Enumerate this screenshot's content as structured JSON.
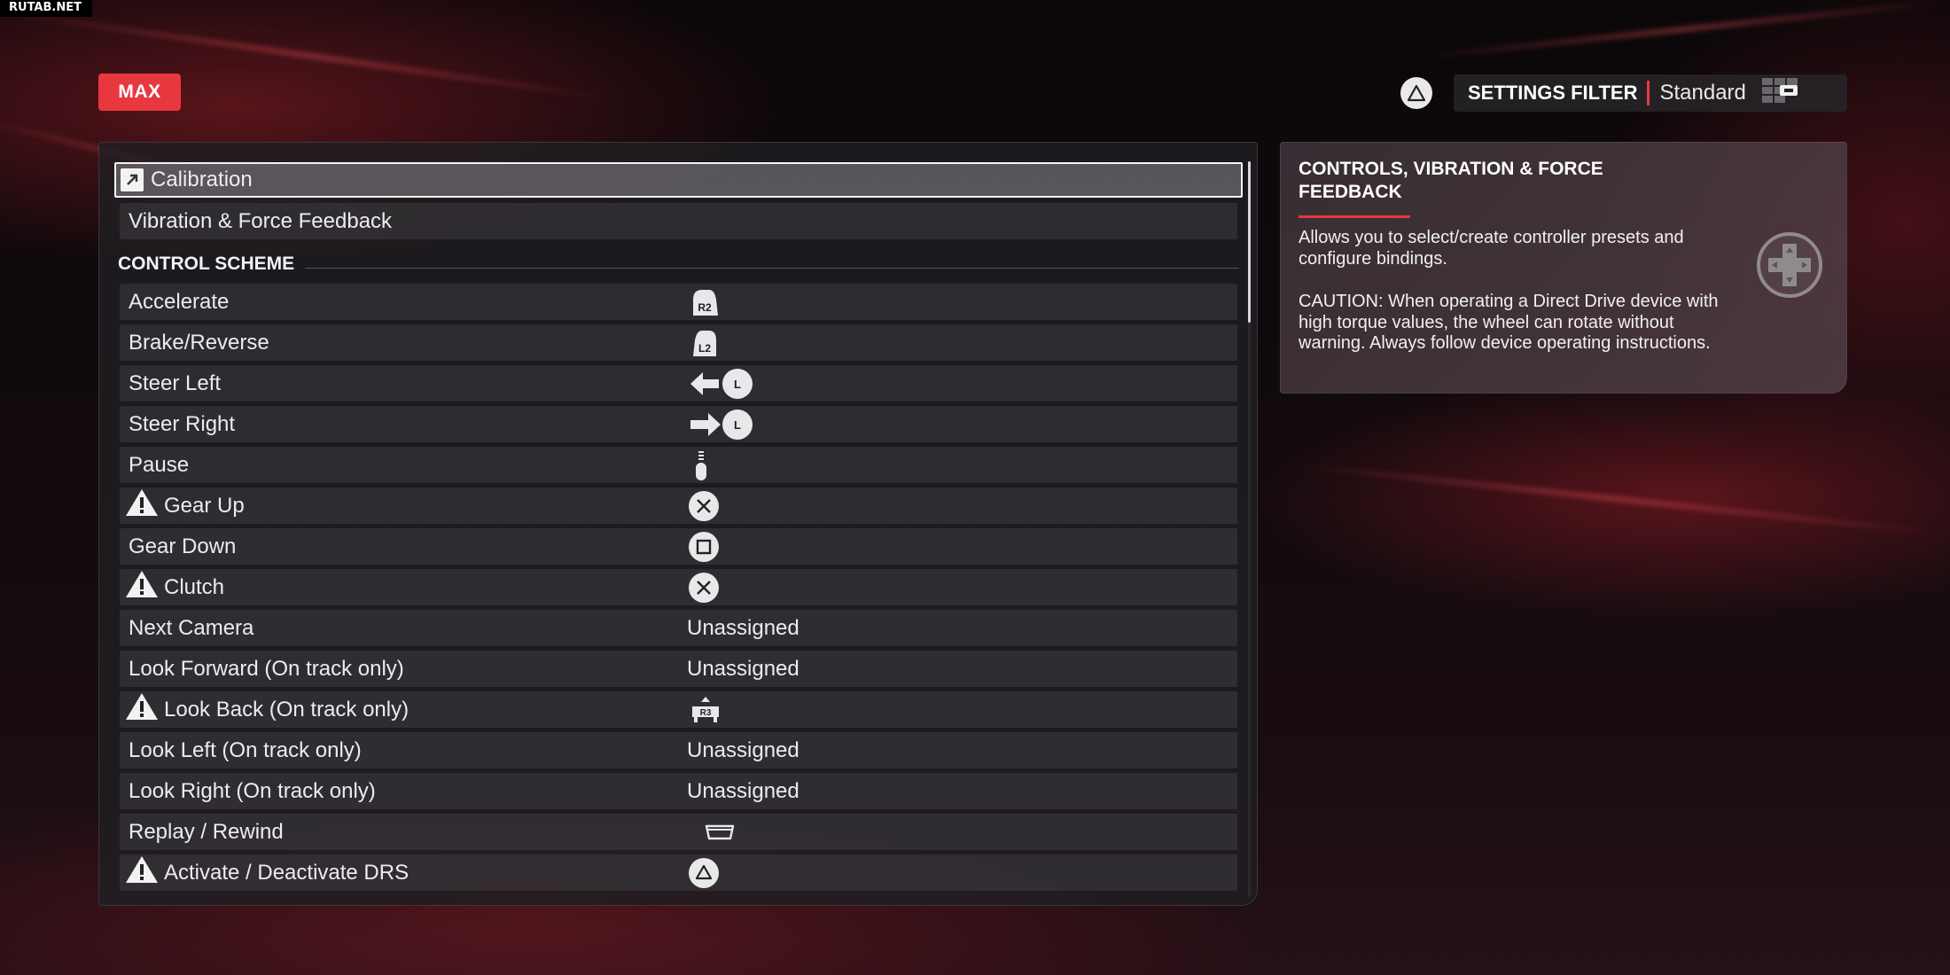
{
  "watermark": "RUTAB.NET",
  "header": {
    "badge": "MAX",
    "filter_label": "SETTINGS FILTER",
    "filter_value": "Standard",
    "filter_button_icon": "triangle-button-icon"
  },
  "menu": {
    "calibration": "Calibration",
    "vibration": "Vibration & Force Feedback"
  },
  "control_scheme": {
    "title": "CONTROL SCHEME",
    "rows": [
      {
        "label": "Accelerate",
        "binding_icon": "r2-trigger-icon"
      },
      {
        "label": "Brake/Reverse",
        "binding_icon": "l2-trigger-icon"
      },
      {
        "label": "Steer Left",
        "binding_icon": "left-stick-left-icon"
      },
      {
        "label": "Steer Right",
        "binding_icon": "left-stick-right-icon"
      },
      {
        "label": "Pause",
        "binding_icon": "options-button-icon"
      },
      {
        "label": "Gear Up",
        "binding_icon": "cross-button-icon",
        "warning": true
      },
      {
        "label": "Gear Down",
        "binding_icon": "square-button-icon"
      },
      {
        "label": "Clutch",
        "binding_icon": "cross-button-icon",
        "warning": true
      },
      {
        "label": "Next Camera",
        "binding": "Unassigned"
      },
      {
        "label": "Look Forward (On track only)",
        "binding": "Unassigned"
      },
      {
        "label": "Look Back (On track only)",
        "binding_icon": "r3-button-icon",
        "warning": true
      },
      {
        "label": "Look Left (On track only)",
        "binding": "Unassigned"
      },
      {
        "label": "Look Right (On track only)",
        "binding": "Unassigned"
      },
      {
        "label": "Replay / Rewind",
        "binding_icon": "touchpad-icon"
      },
      {
        "label": "Activate / Deactivate DRS",
        "binding_icon": "triangle-button-icon",
        "warning": true
      }
    ]
  },
  "info": {
    "title": "CONTROLS, VIBRATION & FORCE FEEDBACK",
    "description": "Allows you to select/create controller presets and configure bindings.",
    "caution": "CAUTION: When operating a Direct Drive device with high torque values, the wheel can rotate without warning. Always follow device operating instructions.",
    "icon": "dpad-icon"
  },
  "colors": {
    "accent": "#e8383f",
    "panel": "#201e22",
    "text": "#e9e9ec"
  }
}
